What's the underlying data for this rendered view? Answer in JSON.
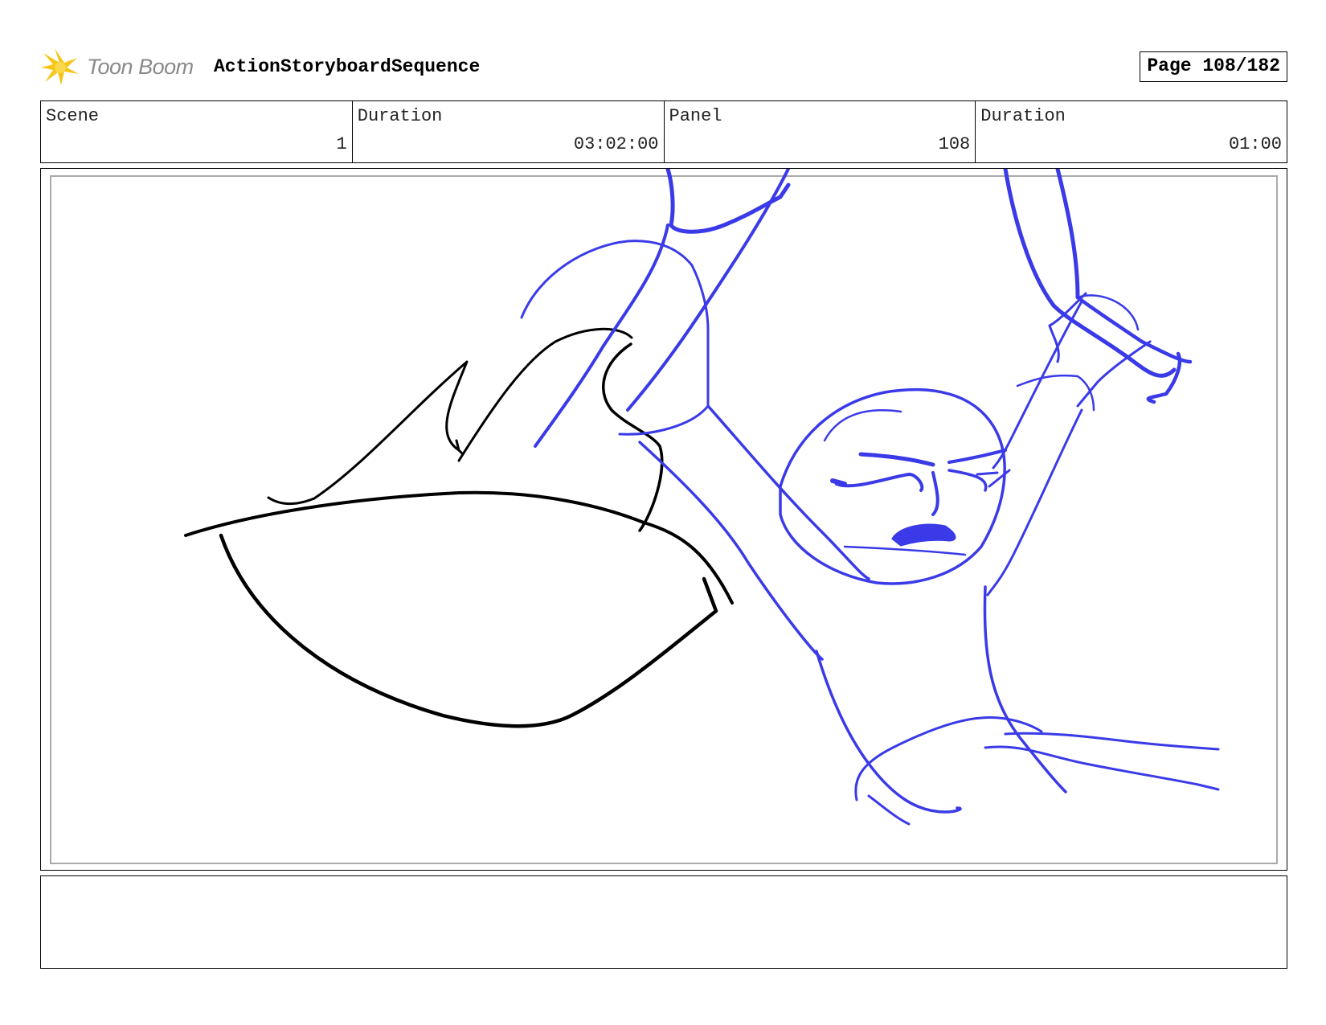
{
  "header": {
    "brand": "Toon Boom",
    "sequence_title": "ActionStoryboardSequence",
    "page_label": "Page 108/182"
  },
  "info": {
    "scene_label": "Scene",
    "scene_value": "1",
    "scene_duration_label": "Duration",
    "scene_duration_value": "03:02:00",
    "panel_label": "Panel",
    "panel_value": "108",
    "panel_duration_label": "Duration",
    "panel_duration_value": "01:00"
  },
  "colors": {
    "sketch_blue": "#3a3ae8",
    "sketch_black": "#000000",
    "logo_yellow": "#f5c518"
  },
  "icons": {
    "logo": "toon-boom-starburst-icon"
  },
  "notes": {
    "text": ""
  }
}
